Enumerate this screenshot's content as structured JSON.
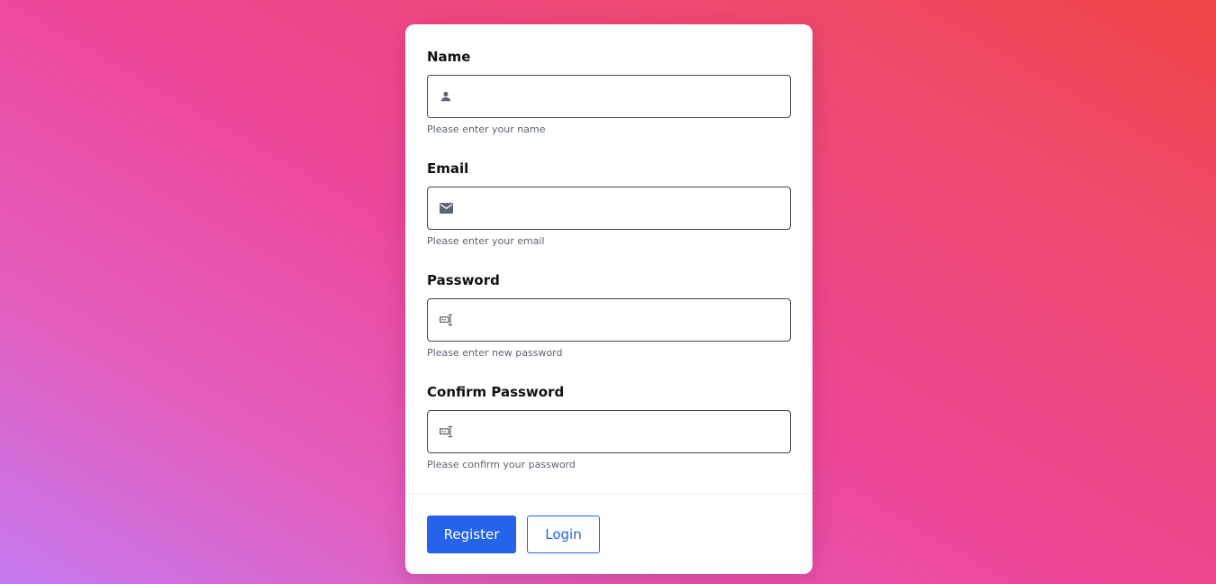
{
  "form": {
    "fields": [
      {
        "label": "Name",
        "icon": "person-icon",
        "value": "",
        "hint": "Please enter your name"
      },
      {
        "label": "Email",
        "icon": "mail-icon",
        "value": "",
        "hint": "Please enter your email"
      },
      {
        "label": "Password",
        "icon": "password-icon",
        "value": "",
        "hint": "Please enter new password"
      },
      {
        "label": "Confirm Password",
        "icon": "password-icon",
        "value": "",
        "hint": "Please confirm your password"
      }
    ]
  },
  "actions": {
    "register_label": "Register",
    "login_label": "Login"
  },
  "colors": {
    "accent": "#2563eb",
    "icon": "#5f6673"
  }
}
